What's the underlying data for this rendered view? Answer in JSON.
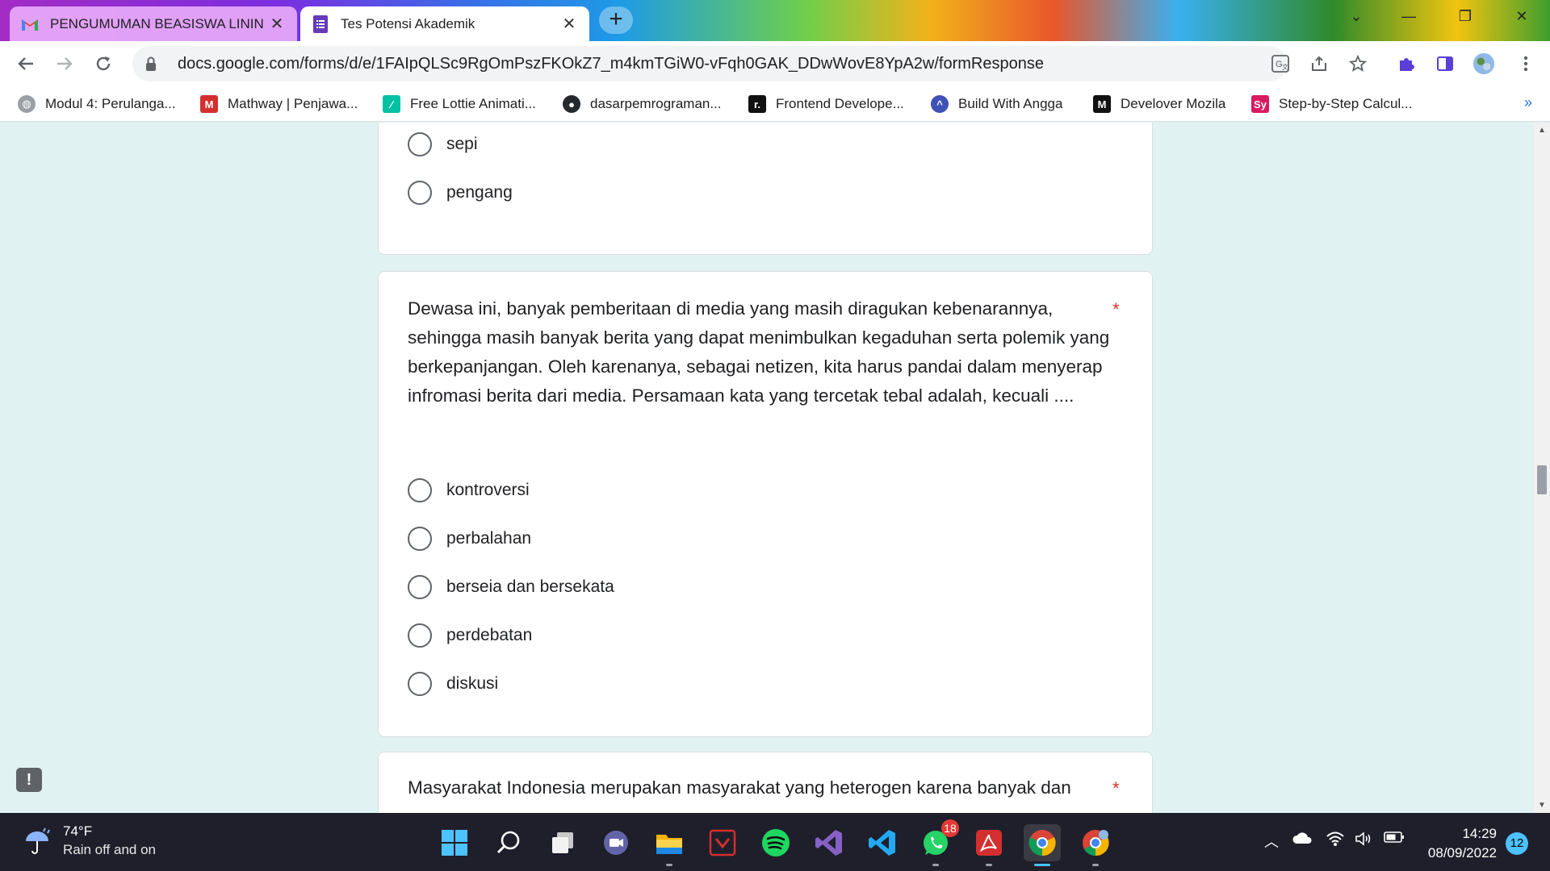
{
  "browser": {
    "tabs": [
      {
        "title": "PENGUMUMAN BEASISWA LININ",
        "icon": "gmail-icon",
        "active": false
      },
      {
        "title": "Tes Potensi Akademik",
        "icon": "google-forms-icon",
        "active": true
      }
    ],
    "new_tab_symbol": "+",
    "url": "docs.google.com/forms/d/e/1FAIpQLSc9RgOmPszFKOkZ7_m4kmTGiW0-vFqh0GAK_DDwWovE8YpA2w/formResponse",
    "bookmarks": [
      {
        "label": "Modul 4: Perulanga...",
        "icon": "globe-icon",
        "color": "#9aa0a6"
      },
      {
        "label": "Mathway | Penjawa...",
        "icon": "mathway-icon",
        "color": "#d32f2f"
      },
      {
        "label": "Free Lottie Animati...",
        "icon": "lottie-icon",
        "color": "#00c1a2"
      },
      {
        "label": "dasarpemrograman...",
        "icon": "github-icon",
        "color": "#24292e"
      },
      {
        "label": "Frontend Develope...",
        "icon": "frontend-icon",
        "color": "#111111"
      },
      {
        "label": "Build With Angga",
        "icon": "bwa-icon",
        "color": "#3f51b5"
      },
      {
        "label": "Develover Mozila",
        "icon": "mdn-icon",
        "color": "#111111"
      },
      {
        "label": "Step-by-Step Calcul...",
        "icon": "symbolab-icon",
        "color": "#d81b60"
      }
    ],
    "more_bookmarks_symbol": "»"
  },
  "form": {
    "prev_question_options": [
      "sepi",
      "pengang"
    ],
    "question": {
      "text": "Dewasa ini, banyak pemberitaan di media yang masih diragukan kebenarannya, sehingga masih banyak berita yang dapat menimbulkan kegaduhan serta polemik yang berkepanjangan. Oleh karenanya, sebagai netizen, kita harus pandai dalam menyerap infromasi berita dari media. Persamaan kata yang tercetak tebal adalah, kecuali ....",
      "required_marker": "*",
      "options": [
        "kontroversi",
        "perbalahan",
        "berseia dan bersekata",
        "perdebatan",
        "diskusi"
      ]
    },
    "next_question": {
      "text": "Masyarakat Indonesia merupakan masyarakat yang heterogen karena banyak dan",
      "required_marker": "*"
    },
    "feedback_symbol": "!"
  },
  "taskbar": {
    "weather": {
      "temp": "74°F",
      "desc": "Rain off and on"
    },
    "apps": [
      {
        "name": "windows-start-icon"
      },
      {
        "name": "search-icon"
      },
      {
        "name": "task-view-icon"
      },
      {
        "name": "teams-chat-icon"
      },
      {
        "name": "file-explorer-icon"
      },
      {
        "name": "mendeley-icon"
      },
      {
        "name": "spotify-icon"
      },
      {
        "name": "visual-studio-icon"
      },
      {
        "name": "vscode-icon"
      },
      {
        "name": "whatsapp-icon",
        "badge": "18"
      },
      {
        "name": "acrobat-icon"
      },
      {
        "name": "chrome-icon",
        "active": true
      },
      {
        "name": "chrome-profile-icon"
      }
    ],
    "clock": {
      "time": "14:29",
      "date": "08/09/2022"
    },
    "notifications": "12"
  }
}
